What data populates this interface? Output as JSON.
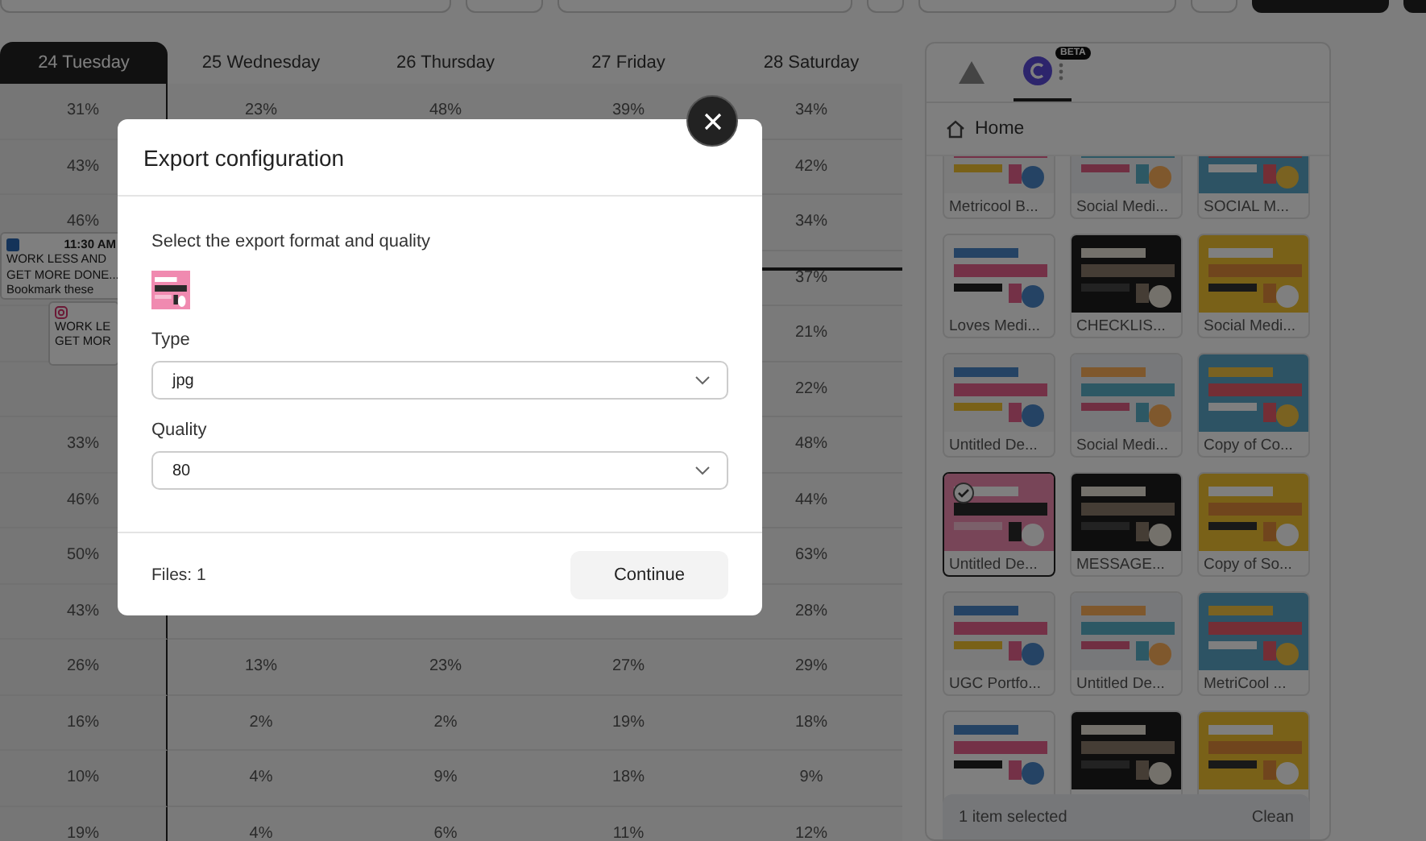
{
  "calendar": {
    "days": [
      {
        "label": "24 Tuesday",
        "selected": true
      },
      {
        "label": "25 Wednesday",
        "selected": false
      },
      {
        "label": "26 Thursday",
        "selected": false
      },
      {
        "label": "27 Friday",
        "selected": false
      },
      {
        "label": "28 Saturday",
        "selected": false
      }
    ],
    "rows": [
      [
        "31%",
        "23%",
        "48%",
        "39%",
        "34%"
      ],
      [
        "43%",
        null,
        null,
        null,
        "42%"
      ],
      [
        "46%",
        null,
        null,
        null,
        "34%"
      ],
      [
        null,
        null,
        null,
        null,
        "37%"
      ],
      [
        null,
        null,
        null,
        null,
        "21%"
      ],
      [
        null,
        null,
        null,
        null,
        "22%"
      ],
      [
        "33%",
        null,
        null,
        null,
        "48%"
      ],
      [
        "46%",
        null,
        null,
        null,
        "44%"
      ],
      [
        "50%",
        null,
        null,
        null,
        "63%"
      ],
      [
        "43%",
        null,
        null,
        null,
        "28%"
      ],
      [
        "26%",
        "13%",
        "23%",
        "27%",
        "29%"
      ],
      [
        "16%",
        "2%",
        "2%",
        "19%",
        "18%"
      ],
      [
        "10%",
        "4%",
        "9%",
        "18%",
        "9%"
      ],
      [
        "19%",
        "4%",
        "6%",
        "11%",
        "12%"
      ]
    ],
    "posts": [
      {
        "kind": "linkedin",
        "time": "11:30 AM",
        "lines": [
          "WORK LESS AND",
          "GET MORE DONE...",
          "Bookmark these"
        ]
      },
      {
        "kind": "instagram",
        "lines": [
          "WORK LE",
          "GET MOR"
        ]
      }
    ]
  },
  "panel": {
    "tabs": [
      {
        "kind": "drive",
        "selected": false
      },
      {
        "kind": "canva",
        "selected": true,
        "badge": "BETA"
      }
    ],
    "breadcrumb": "Home",
    "items": [
      {
        "caption": "Metricool B...",
        "selected": false
      },
      {
        "caption": "Social Medi...",
        "selected": false
      },
      {
        "caption": "SOCIAL M...",
        "selected": false
      },
      {
        "caption": "Loves Medi...",
        "selected": false
      },
      {
        "caption": "CHECKLIS...",
        "selected": false
      },
      {
        "caption": "Social Medi...",
        "selected": false
      },
      {
        "caption": "Untitled De...",
        "selected": false
      },
      {
        "caption": "Social Medi...",
        "selected": false
      },
      {
        "caption": "Copy of Co...",
        "selected": false
      },
      {
        "caption": "Untitled De...",
        "selected": true
      },
      {
        "caption": "MESSAGE...",
        "selected": false
      },
      {
        "caption": "Copy of So...",
        "selected": false
      },
      {
        "caption": "UGC Portfo...",
        "selected": false
      },
      {
        "caption": "Untitled De...",
        "selected": false
      },
      {
        "caption": "MetriCool ...",
        "selected": false
      },
      {
        "selected": false
      },
      {
        "selected": false
      },
      {
        "selected": false
      }
    ],
    "selection": {
      "count": "1 item selected",
      "action": "Clean"
    }
  },
  "modal": {
    "title": "Export configuration",
    "prompt": "Select the export format and quality",
    "fields": [
      {
        "label": "Type",
        "value": "jpg"
      },
      {
        "label": "Quality",
        "value": "80"
      }
    ],
    "files": "Files: 1",
    "button": "Continue"
  }
}
